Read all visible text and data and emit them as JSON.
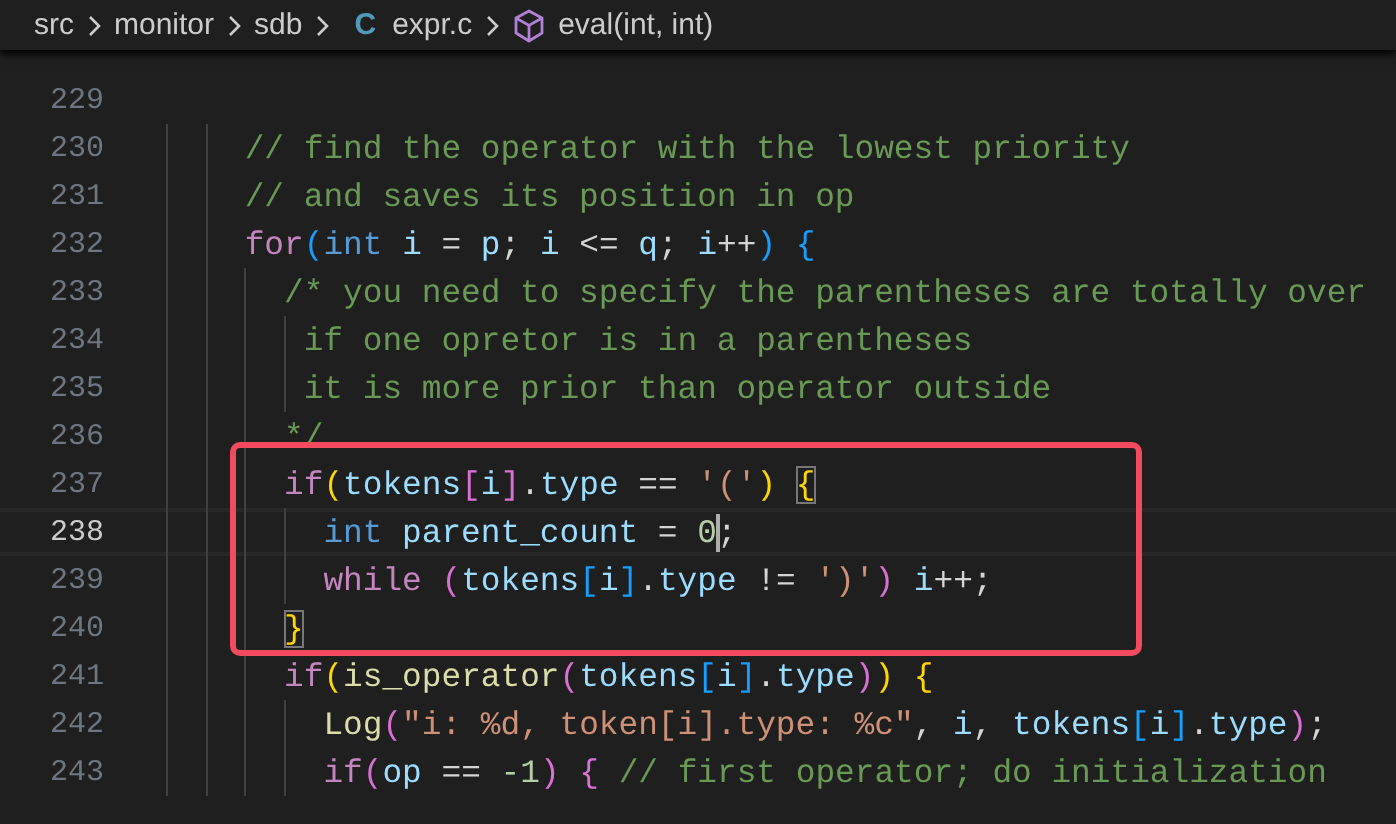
{
  "breadcrumb": [
    {
      "text": "src",
      "kind": "folder"
    },
    {
      "text": "monitor",
      "kind": "folder"
    },
    {
      "text": "sdb",
      "kind": "folder"
    },
    {
      "text": "expr.c",
      "kind": "file",
      "icon_text": "C"
    },
    {
      "text": "eval(int, int)",
      "kind": "symbol"
    }
  ],
  "lines": [
    {
      "number": "229",
      "current": false,
      "boxed": false
    },
    {
      "number": "230",
      "current": false,
      "boxed": false,
      "tokens": [
        {
          "text": "    // find the operator with the lowest priority",
          "kind": "comment"
        }
      ]
    },
    {
      "number": "231",
      "current": false,
      "boxed": false,
      "tokens": [
        {
          "text": "    // and saves its position in op",
          "kind": "comment"
        }
      ]
    },
    {
      "number": "232",
      "current": false,
      "boxed": false,
      "tokens": [
        {
          "text": "    for",
          "kind": "keyword"
        },
        {
          "text": "(",
          "kind": "bracket3"
        },
        {
          "text": "int ",
          "kind": "type"
        },
        {
          "text": "i",
          "kind": "var"
        },
        {
          "text": " = ",
          "kind": "plain"
        },
        {
          "text": "p",
          "kind": "var"
        },
        {
          "text": "; ",
          "kind": "plain"
        },
        {
          "text": "i",
          "kind": "var"
        },
        {
          "text": " <= ",
          "kind": "plain"
        },
        {
          "text": "q",
          "kind": "var"
        },
        {
          "text": "; ",
          "kind": "plain"
        },
        {
          "text": "i",
          "kind": "var"
        },
        {
          "text": "++",
          "kind": "plain"
        },
        {
          "text": ") ",
          "kind": "bracket3"
        },
        {
          "text": "{",
          "kind": "bracket3"
        }
      ]
    },
    {
      "number": "233",
      "current": false,
      "boxed": false,
      "tokens": [
        {
          "text": "      /* you need to specify the parentheses are totally over",
          "kind": "comment"
        }
      ]
    },
    {
      "number": "234",
      "current": false,
      "boxed": false,
      "tokens": [
        {
          "text": "       if one opretor is in a parentheses",
          "kind": "comment"
        }
      ]
    },
    {
      "number": "235",
      "current": false,
      "boxed": false,
      "tokens": [
        {
          "text": "       it is more prior than operator outside",
          "kind": "comment"
        }
      ]
    },
    {
      "number": "236",
      "current": false,
      "boxed": false,
      "tokens": [
        {
          "text": "      */",
          "kind": "comment"
        }
      ]
    },
    {
      "number": "237",
      "current": false,
      "boxed": true,
      "tokens": [
        {
          "text": "      if",
          "kind": "keyword"
        },
        {
          "text": "(",
          "kind": "bracket1"
        },
        {
          "text": "tokens",
          "kind": "var"
        },
        {
          "text": "[",
          "kind": "bracket2"
        },
        {
          "text": "i",
          "kind": "var"
        },
        {
          "text": "]",
          "kind": "bracket2"
        },
        {
          "text": ".",
          "kind": "plain"
        },
        {
          "text": "type",
          "kind": "var"
        },
        {
          "text": " == ",
          "kind": "plain"
        },
        {
          "text": "'('",
          "kind": "string"
        },
        {
          "text": ") ",
          "kind": "bracket1"
        },
        {
          "text": "{",
          "kind": "bracket1",
          "matched": true
        }
      ]
    },
    {
      "number": "238",
      "current": true,
      "boxed": true,
      "tokens": [
        {
          "text": "        int ",
          "kind": "type"
        },
        {
          "text": "parent_count",
          "kind": "var"
        },
        {
          "text": " = ",
          "kind": "plain"
        },
        {
          "text": "0",
          "kind": "num",
          "cursor": true
        },
        {
          "text": ";",
          "kind": "plain"
        }
      ]
    },
    {
      "number": "239",
      "current": false,
      "boxed": true,
      "tokens": [
        {
          "text": "        while ",
          "kind": "keyword"
        },
        {
          "text": "(",
          "kind": "bracket2"
        },
        {
          "text": "tokens",
          "kind": "var"
        },
        {
          "text": "[",
          "kind": "bracket3"
        },
        {
          "text": "i",
          "kind": "var"
        },
        {
          "text": "]",
          "kind": "bracket3"
        },
        {
          "text": ".",
          "kind": "plain"
        },
        {
          "text": "type",
          "kind": "var"
        },
        {
          "text": " != ",
          "kind": "plain"
        },
        {
          "text": "')'",
          "kind": "string"
        },
        {
          "text": ") ",
          "kind": "bracket2"
        },
        {
          "text": "i",
          "kind": "var"
        },
        {
          "text": "++;",
          "kind": "plain"
        }
      ]
    },
    {
      "number": "240",
      "current": false,
      "boxed": true,
      "tokens": [
        {
          "text": "      }",
          "kind": "bracket1",
          "matched": true
        }
      ]
    },
    {
      "number": "241",
      "current": false,
      "boxed": false,
      "tokens": [
        {
          "text": "      if",
          "kind": "keyword"
        },
        {
          "text": "(",
          "kind": "bracket1"
        },
        {
          "text": "is_operator",
          "kind": "function"
        },
        {
          "text": "(",
          "kind": "bracket2"
        },
        {
          "text": "tokens",
          "kind": "var"
        },
        {
          "text": "[",
          "kind": "bracket3"
        },
        {
          "text": "i",
          "kind": "var"
        },
        {
          "text": "]",
          "kind": "bracket3"
        },
        {
          "text": ".",
          "kind": "plain"
        },
        {
          "text": "type",
          "kind": "var"
        },
        {
          "text": ")",
          "kind": "bracket2"
        },
        {
          "text": ") ",
          "kind": "bracket1"
        },
        {
          "text": "{",
          "kind": "bracket1"
        }
      ]
    },
    {
      "number": "242",
      "current": false,
      "boxed": false,
      "tokens": [
        {
          "text": "        Log",
          "kind": "function"
        },
        {
          "text": "(",
          "kind": "bracket2"
        },
        {
          "text": "\"i: %d, token[i].type: %c\"",
          "kind": "string"
        },
        {
          "text": ", ",
          "kind": "plain"
        },
        {
          "text": "i",
          "kind": "var"
        },
        {
          "text": ", ",
          "kind": "plain"
        },
        {
          "text": "tokens",
          "kind": "var"
        },
        {
          "text": "[",
          "kind": "bracket3"
        },
        {
          "text": "i",
          "kind": "var"
        },
        {
          "text": "]",
          "kind": "bracket3"
        },
        {
          "text": ".",
          "kind": "plain"
        },
        {
          "text": "type",
          "kind": "var"
        },
        {
          "text": ")",
          "kind": "bracket2"
        },
        {
          "text": ";",
          "kind": "plain"
        }
      ]
    },
    {
      "number": "243",
      "current": false,
      "boxed": false,
      "tokens": [
        {
          "text": "        if",
          "kind": "keyword"
        },
        {
          "text": "(",
          "kind": "bracket2"
        },
        {
          "text": "op",
          "kind": "var"
        },
        {
          "text": " == ",
          "kind": "plain"
        },
        {
          "text": "-1",
          "kind": "num"
        },
        {
          "text": ") ",
          "kind": "bracket2"
        },
        {
          "text": "{ ",
          "kind": "bracket2"
        },
        {
          "text": "// first operator; do initialization",
          "kind": "comment"
        }
      ]
    }
  ]
}
